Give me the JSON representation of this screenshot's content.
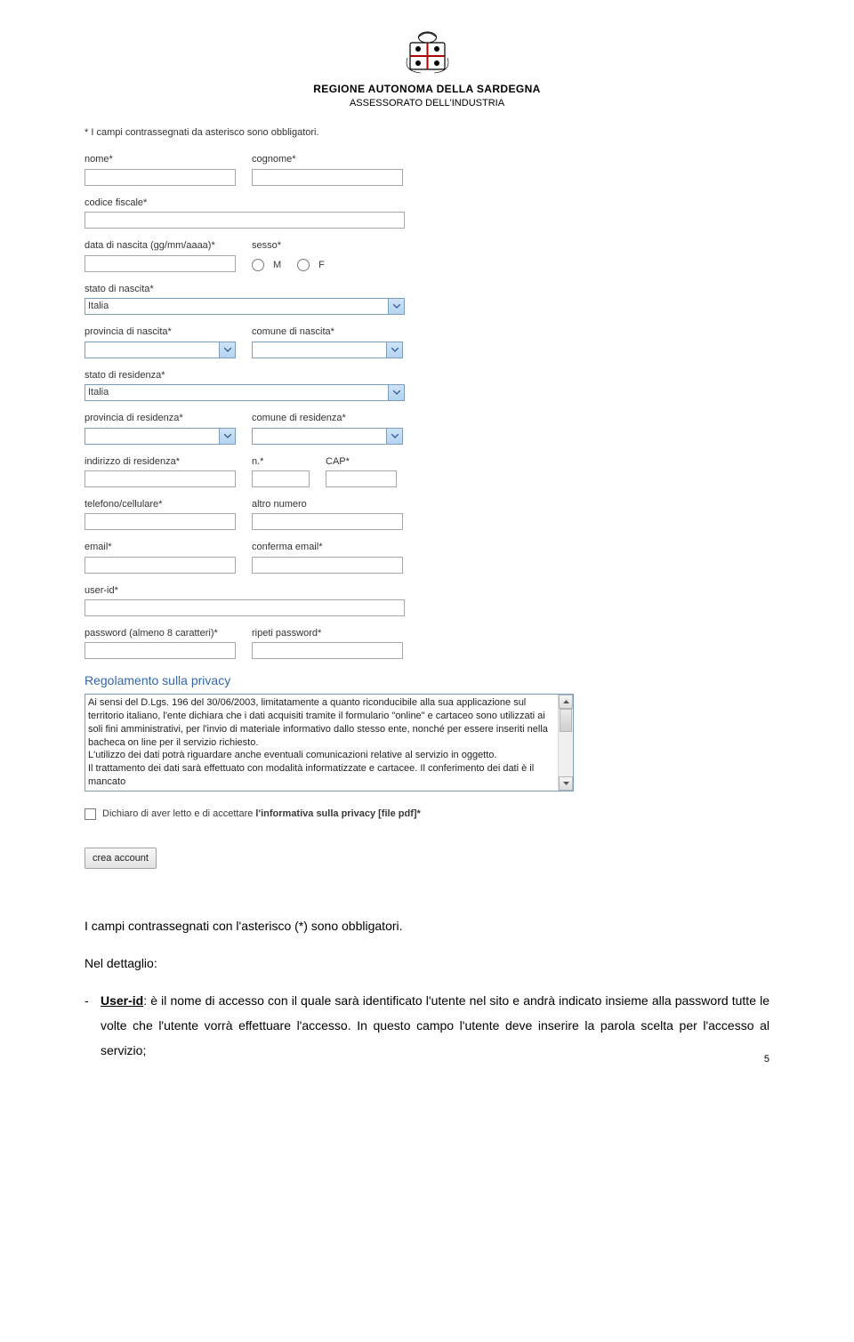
{
  "header": {
    "region_title": "REGIONE AUTONOMA DELLA SARDEGNA",
    "region_sub": "ASSESSORATO DELL'INDUSTRIA"
  },
  "form": {
    "hint": "* I campi contrassegnati da asterisco sono obbligatori.",
    "labels": {
      "nome": "nome*",
      "cognome": "cognome*",
      "codice_fiscale": "codice fiscale*",
      "data_nascita": "data di nascita (gg/mm/aaaa)*",
      "sesso": "sesso*",
      "sesso_m": "M",
      "sesso_f": "F",
      "stato_nascita": "stato di nascita*",
      "provincia_nascita": "provincia di nascita*",
      "comune_nascita": "comune di nascita*",
      "stato_residenza": "stato di residenza*",
      "provincia_residenza": "provincia di residenza*",
      "comune_residenza": "comune di residenza*",
      "indirizzo_residenza": "indirizzo di residenza*",
      "numero_civico": "n.*",
      "cap": "CAP*",
      "telefono": "telefono/cellulare*",
      "altro_numero": "altro numero",
      "email": "email*",
      "conferma_email": "conferma email*",
      "user_id": "user-id*",
      "password": "password (almeno 8 caratteri)*",
      "ripeti_password": "ripeti password*"
    },
    "values": {
      "stato_nascita": "Italia",
      "stato_residenza": "Italia"
    },
    "privacy": {
      "title": "Regolamento sulla privacy",
      "text": "Ai sensi del D.Lgs. 196 del 30/06/2003, limitatamente a quanto riconducibile alla sua applicazione sul territorio italiano, l'ente dichiara che i dati acquisiti tramite il formulario \"online\" e cartaceo sono utilizzati ai soli fini amministrativi, per l'invio di materiale informativo dallo stesso ente, nonché per essere inseriti nella bacheca on line per il servizio richiesto.\nL'utilizzo dei dati potrà riguardare anche eventuali comunicazioni relative al servizio in oggetto.\nIl trattamento dei dati sarà effettuato con modalità informatizzate e cartacee. Il conferimento dei dati è il mancato",
      "checkbox_label_before": "Dichiaro di aver letto e di accettare ",
      "checkbox_label_bold": "l'informativa sulla privacy [file pdf]*"
    },
    "submit": "crea account"
  },
  "body": {
    "intro": "I campi contrassegnati con l'asterisco (*) sono obbligatori.",
    "detail_heading": "Nel dettaglio:",
    "bullet": "-",
    "userid_label": "User-id",
    "userid_text": ": è il nome di accesso con il quale sarà identificato l'utente nel sito e andrà indicato insieme alla password tutte le volte che l'utente vorrà effettuare l'accesso. In questo campo l'utente deve inserire la parola scelta per l'accesso al servizio;"
  },
  "page_number": "5"
}
